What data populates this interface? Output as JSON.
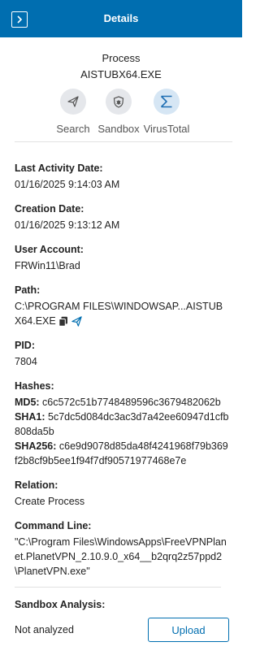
{
  "header": {
    "title": "Details"
  },
  "summary": {
    "type": "Process",
    "name": "AISTUBX64.EXE"
  },
  "actions": [
    {
      "label": "Search",
      "icon": "send-icon"
    },
    {
      "label": "Sandbox",
      "icon": "shield-bug-icon"
    },
    {
      "label": "VirusTotal",
      "icon": "sigma-icon"
    }
  ],
  "fields": {
    "last_activity": {
      "label": "Last Activity Date:",
      "value": "01/16/2025 9:14:03 AM"
    },
    "creation": {
      "label": "Creation Date:",
      "value": "01/16/2025 9:13:12 AM"
    },
    "user": {
      "label": "User Account:",
      "value": "FRWin11\\Brad"
    },
    "path": {
      "label": "Path:",
      "value": "C:\\PROGRAM FILES\\WINDOWSAP...AISTUBX64.EXE"
    },
    "pid": {
      "label": "PID:",
      "value": "7804"
    },
    "hashes": {
      "label": "Hashes:",
      "md5_label": "MD5:",
      "md5": "c6c572c51b7748489596c3679482062b",
      "sha1_label": "SHA1:",
      "sha1": "5c7dc5d084dc3ac3d7a42ee60947d1cfb808da5b",
      "sha256_label": "SHA256:",
      "sha256": "c6e9d9078d85da48f4241968f79b369f2b8cf9b5ee1f94f7df90571977468e7e"
    },
    "relation": {
      "label": "Relation:",
      "value": "Create Process"
    },
    "command": {
      "label": "Command Line:",
      "value": "\"C:\\Program Files\\WindowsApps\\FreeVPNPlanet.PlanetVPN_2.10.9.0_x64__b2qrq2z57ppd2\\PlanetVPN.exe\""
    }
  },
  "sandbox": {
    "label": "Sandbox Analysis:",
    "status": "Not analyzed",
    "button": "Upload"
  },
  "colors": {
    "header": "#006eb0",
    "accent": "#006eb0"
  }
}
